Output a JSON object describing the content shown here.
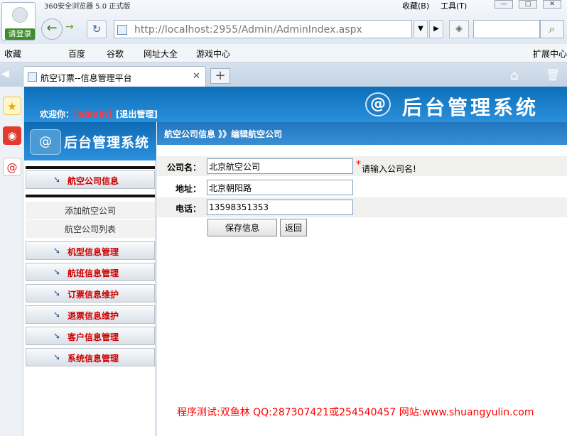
{
  "browser": {
    "title": "360安全浏览器 5.0 正式版",
    "login_label": "请登录",
    "menu_fav": "收藏(B)",
    "menu_tools": "工具(T)",
    "address": "http://localhost:2955/Admin/AdminIndex.aspx",
    "bookmarks": [
      "收藏",
      "百度",
      "谷歌",
      "网址大全",
      "游戏中心"
    ],
    "ext_center": "扩展中心",
    "tab_title": "航空订票--信息管理平台"
  },
  "header": {
    "welcome": "欢迎你：",
    "user": "[admin]",
    "logout": "[退出管理]",
    "logo_text": "后台管理系统",
    "logo_symbol": "@"
  },
  "sidebar": {
    "logo_text": "后台管理系统",
    "section_airline": "航空公司信息",
    "sub_items": [
      "添加航空公司",
      "航空公司列表"
    ],
    "menus": [
      "机型信息管理",
      "航班信息管理",
      "订票信息维护",
      "退票信息维护",
      "客户信息管理",
      "系统信息管理"
    ]
  },
  "content": {
    "breadcrumb": "航空公司信息 》》编辑航空公司",
    "fields": {
      "company_label": "公司名：",
      "company_value": "北京航空公司",
      "address_label": "地址：",
      "address_value": "北京朝阳路",
      "phone_label": "电话：",
      "phone_value": "13598351353"
    },
    "required_hint": "请输入公司名!",
    "required_mark": "*",
    "save_button": "保存信息",
    "back_button": "返回"
  },
  "footer": "程序测试:双鱼林  QQ:287307421或254540457 网站:www.shuangyulin.com",
  "icons": [
    "user-avatar-icon",
    "back-arrow-icon",
    "forward-arrow-icon",
    "refresh-icon",
    "page-icon",
    "dropdown-icon",
    "go-icon",
    "shield-icon",
    "search-icon",
    "star-icon",
    "weibo-icon",
    "mail-icon",
    "home-icon",
    "trash-icon",
    "menu-arrow-icon"
  ],
  "colors": {
    "header_blue": "#1a7fcc",
    "menu_red": "#cc0000",
    "footer_red": "#ff0000"
  }
}
